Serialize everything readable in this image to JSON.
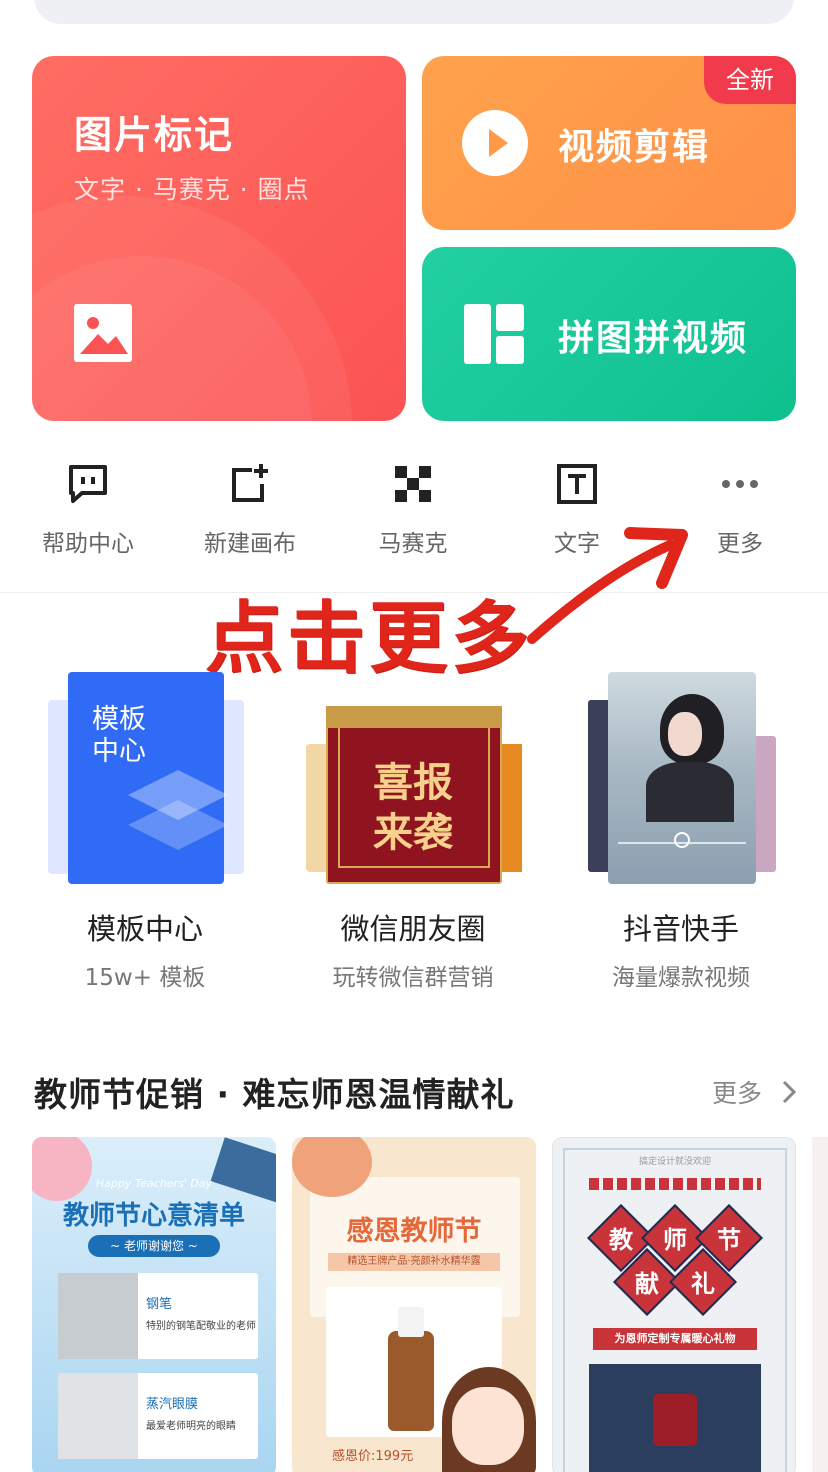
{
  "cards": {
    "image_mark": {
      "title": "图片标记",
      "subtitle": "文字 · 马赛克 · 圈点",
      "icon": "image-icon"
    },
    "video_edit": {
      "label": "视频剪辑",
      "badge": "全新",
      "icon": "play-icon"
    },
    "collage": {
      "label": "拼图拼视频",
      "icon": "collage-icon"
    }
  },
  "tools": [
    {
      "label": "帮助中心",
      "icon": "chat-icon"
    },
    {
      "label": "新建画布",
      "icon": "new-canvas-icon"
    },
    {
      "label": "马赛克",
      "icon": "mosaic-icon"
    },
    {
      "label": "文字",
      "icon": "text-icon"
    },
    {
      "label": "更多",
      "icon": "more-dots-icon"
    }
  ],
  "annotation": {
    "callout": "点击更多"
  },
  "templates": [
    {
      "name": "模板中心",
      "sub": "15w+ 模板",
      "thumb_text": "模板\n中心"
    },
    {
      "name": "微信朋友圈",
      "sub": "玩转微信群营销",
      "thumb_text_1": "喜报",
      "thumb_text_2": "来袭"
    },
    {
      "name": "抖音快手",
      "sub": "海量爆款视频"
    }
  ],
  "section": {
    "title": "教师节促销 · 难忘师恩温情献礼",
    "more": "更多"
  },
  "posters": [
    {
      "en": "Happy Teachers' Day",
      "title": "教师节心意清单",
      "ribbon": "~ 老师谢谢您 ~",
      "item1_title": "钢笔",
      "item1_desc": "特别的钢笔配敬业的老师",
      "item2_title": "蒸汽眼膜",
      "item2_desc": "最爱老师明亮的眼睛"
    },
    {
      "title": "感恩教师节",
      "sub": "精选王牌产品·亮颜补水精华露",
      "price": "感恩价:199元"
    },
    {
      "top": "搞定设计就没欢迎",
      "chars": [
        "教",
        "师",
        "节",
        "献",
        "礼"
      ],
      "banner": "为恩师定制专属暖心礼物"
    }
  ],
  "colors": {
    "red_card": "#fb5353",
    "orange_card": "#ff9848",
    "green_card": "#14c494",
    "callout": "#e0251b",
    "template_blue": "#2f6bf5"
  }
}
